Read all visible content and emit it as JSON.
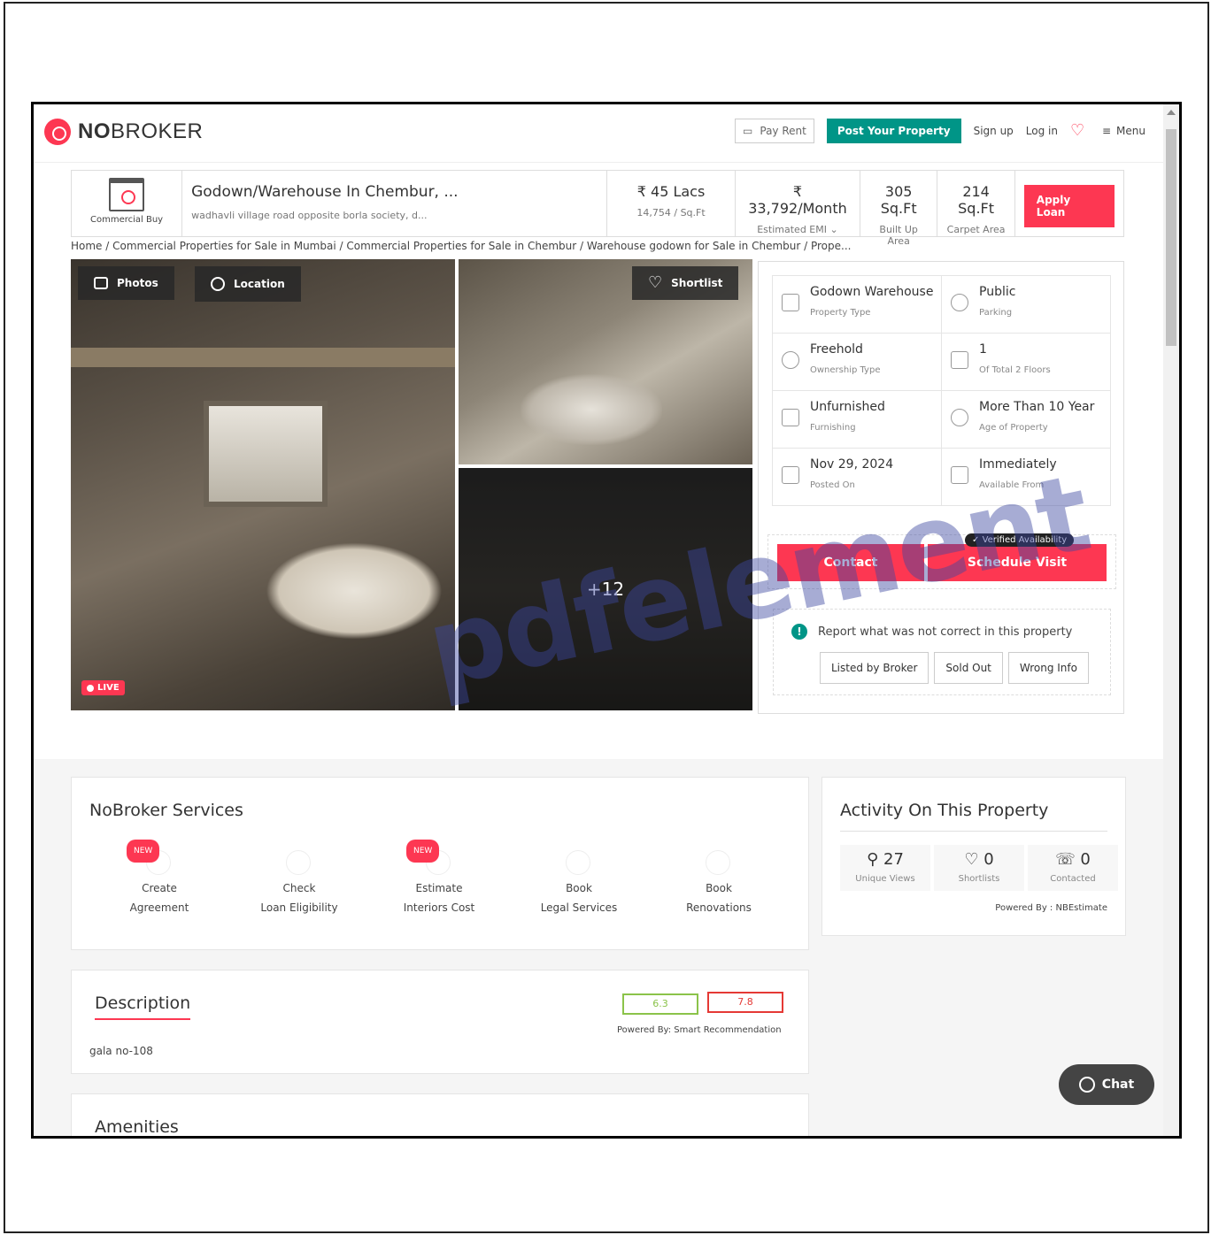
{
  "brand": {
    "logo_prefix": "NO",
    "logo_suffix": "BROKER"
  },
  "nav": {
    "pay_rent": "Pay Rent",
    "post_property": "Post Your Property",
    "sign_up": "Sign up",
    "log_in": "Log in",
    "menu": "Menu"
  },
  "summary": {
    "category": "Commercial Buy",
    "title": "Godown/Warehouse In Chembur, ...",
    "address": "wadhavli village road opposite borla society, d...",
    "price": "₹ 45 Lacs",
    "price_per_sqft": "14,754 / Sq.Ft",
    "emi": "₹ 33,792/Month",
    "emi_label": "Estimated EMI",
    "built_up": "305 Sq.Ft",
    "built_up_label": "Built Up Area",
    "carpet": "214 Sq.Ft",
    "carpet_label": "Carpet Area",
    "apply_loan": "Apply Loan"
  },
  "breadcrumb": "Home / Commercial Properties for Sale in Mumbai / Commercial Properties for Sale in Chembur / Warehouse godown for Sale in Chembur / Prope...",
  "gallery": {
    "photos_label": "Photos",
    "location_label": "Location",
    "shortlist_label": "Shortlist",
    "more_count": "+12",
    "live_label": "LIVE"
  },
  "specs": [
    {
      "value": "Godown Warehouse",
      "label": "Property Type"
    },
    {
      "value": "Public",
      "label": "Parking"
    },
    {
      "value": "Freehold",
      "label": "Ownership Type"
    },
    {
      "value": "1",
      "label": "Of Total 2 Floors"
    },
    {
      "value": "Unfurnished",
      "label": "Furnishing"
    },
    {
      "value": "More Than 10 Year",
      "label": "Age of Property"
    },
    {
      "value": "Nov 29, 2024",
      "label": "Posted On"
    },
    {
      "value": "Immediately",
      "label": "Available From"
    }
  ],
  "cta": {
    "contact": "Contact",
    "schedule_visit": "Schedule Visit",
    "verified": "Verified Availability"
  },
  "report": {
    "text": "Report what was not correct in this property",
    "buttons": [
      "Listed by Broker",
      "Sold Out",
      "Wrong Info"
    ]
  },
  "services": {
    "title": "NoBroker Services",
    "new_tag": "NEW",
    "items": [
      {
        "line1": "Create",
        "line2": "Agreement"
      },
      {
        "line1": "Check",
        "line2": "Loan Eligibility"
      },
      {
        "line1": "Estimate",
        "line2": "Interiors Cost"
      },
      {
        "line1": "Book",
        "line2": "Legal Services"
      },
      {
        "line1": "Book",
        "line2": "Renovations"
      }
    ]
  },
  "activity": {
    "title": "Activity On This Property",
    "unique_views": "27",
    "unique_views_label": "Unique Views",
    "shortlists": "0",
    "shortlists_label": "Shortlists",
    "contacted": "0",
    "contacted_label": "Contacted",
    "powered_by": "Powered By : NBEstimate"
  },
  "description": {
    "title": "Description",
    "text": "gala no-108",
    "score_a": "6.3",
    "score_b": "7.8",
    "powered_by": "Powered By: Smart Recommendation"
  },
  "amenities": {
    "title": "Amenities"
  },
  "chat": {
    "label": "Chat"
  },
  "watermark": "pdfelement",
  "colors": {
    "brand": "#fd3752",
    "teal": "#009587"
  }
}
